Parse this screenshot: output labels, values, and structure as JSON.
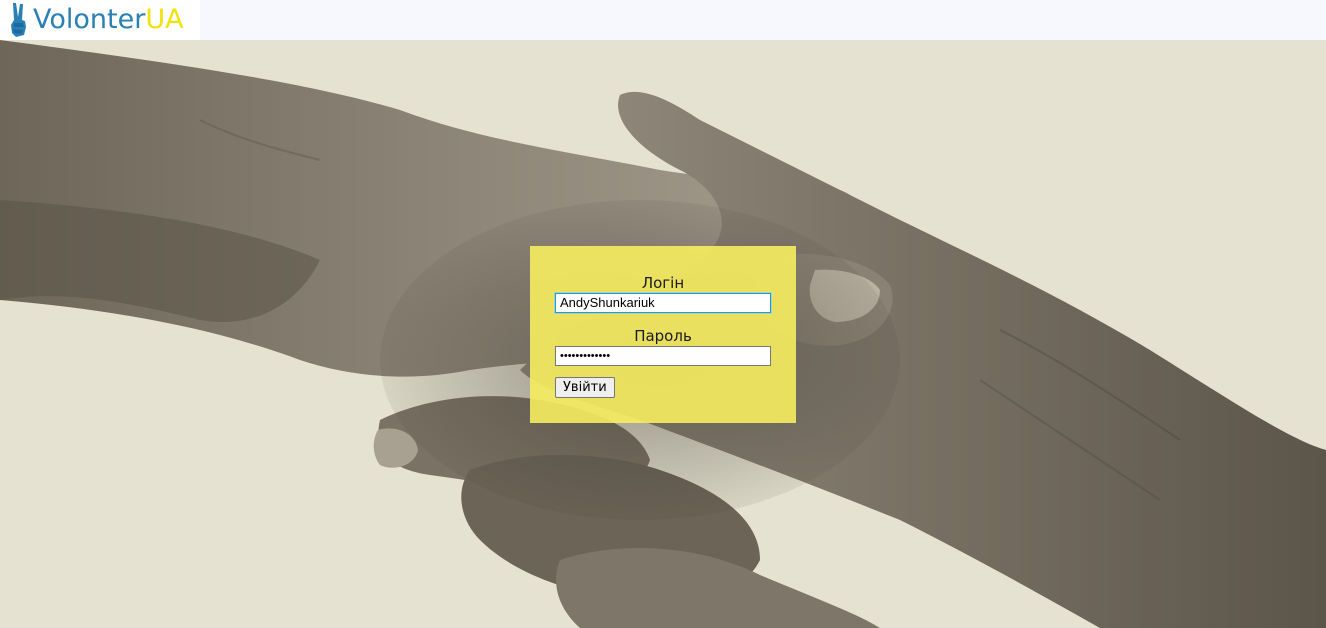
{
  "header": {
    "logo_icon": "victory-hand-icon",
    "logo_text_main": "Volonter",
    "logo_text_accent": "UA",
    "colors": {
      "brand_blue": "#2a7fb5",
      "brand_yellow": "#f1e20c",
      "header_bg": "#f7f8fd"
    }
  },
  "hero": {
    "image": "handshake-photo",
    "background": "#e5e2d1"
  },
  "login": {
    "panel_color": "#f7ed60",
    "login_label": "Логін",
    "login_value": "AndyShunkariuk",
    "password_label": "Пароль",
    "password_value": "•••••••••••••",
    "submit_label": "Увійти"
  }
}
